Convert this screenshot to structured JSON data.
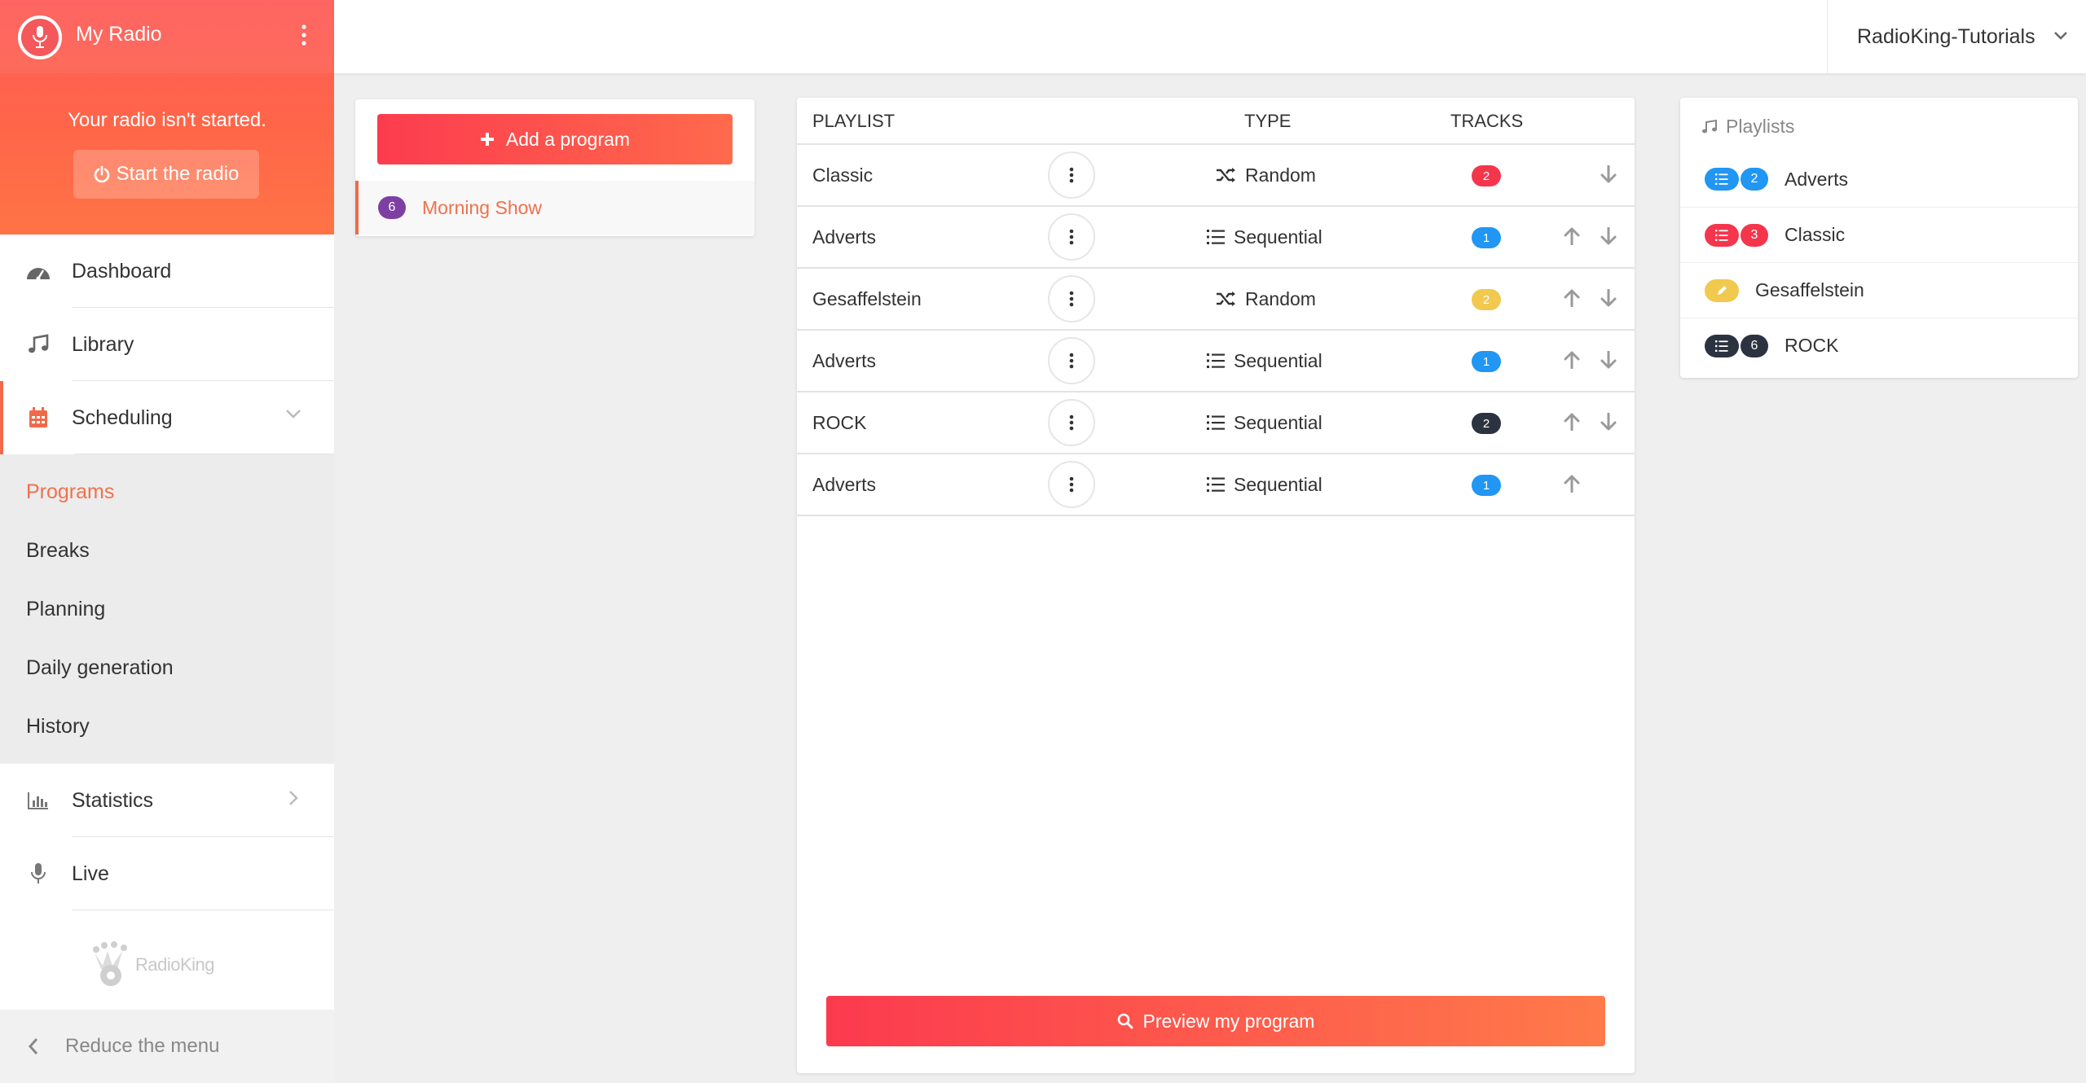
{
  "sidebar": {
    "radio_name": "My Radio",
    "status": "Your radio isn't started.",
    "start_label": "Start the radio",
    "nav": [
      {
        "label": "Dashboard",
        "icon": "dashboard-icon"
      },
      {
        "label": "Library",
        "icon": "music-note-icon"
      },
      {
        "label": "Scheduling",
        "icon": "calendar-icon"
      },
      {
        "label": "Statistics",
        "icon": "bar-chart-icon"
      },
      {
        "label": "Live",
        "icon": "microphone-icon"
      }
    ],
    "submenu": [
      "Programs",
      "Breaks",
      "Planning",
      "Daily generation",
      "History"
    ],
    "brand": "RadioKing",
    "reduce_label": "Reduce the menu"
  },
  "topbar": {
    "account": "RadioKing-Tutorials"
  },
  "programs": {
    "add_label": "Add a program",
    "items": [
      {
        "count": "6",
        "name": "Morning Show"
      }
    ]
  },
  "table": {
    "headers": {
      "playlist": "PLAYLIST",
      "type": "TYPE",
      "tracks": "TRACKS"
    },
    "rows": [
      {
        "playlist": "Classic",
        "type": "Random",
        "tracks": "2",
        "color": "#f4364c",
        "up": false,
        "down": true
      },
      {
        "playlist": "Adverts",
        "type": "Sequential",
        "tracks": "1",
        "color": "#2196f3",
        "up": true,
        "down": true
      },
      {
        "playlist": "Gesaffelstein",
        "type": "Random",
        "tracks": "2",
        "color": "#f0c94e",
        "up": true,
        "down": true
      },
      {
        "playlist": "Adverts",
        "type": "Sequential",
        "tracks": "1",
        "color": "#2196f3",
        "up": true,
        "down": true
      },
      {
        "playlist": "ROCK",
        "type": "Sequential",
        "tracks": "2",
        "color": "#2b3340",
        "up": true,
        "down": true
      },
      {
        "playlist": "Adverts",
        "type": "Sequential",
        "tracks": "1",
        "color": "#2196f3",
        "up": true,
        "down": false
      }
    ],
    "preview_label": "Preview my program"
  },
  "playlists_panel": {
    "title": "Playlists",
    "items": [
      {
        "name": "Adverts",
        "count": "2",
        "color": "#2196f3",
        "icon": "list-icon"
      },
      {
        "name": "Classic",
        "count": "3",
        "color": "#f4364c",
        "icon": "list-icon"
      },
      {
        "name": "Gesaffelstein",
        "count": "",
        "color": "#f0c94e",
        "icon": "pencil-icon"
      },
      {
        "name": "ROCK",
        "count": "6",
        "color": "#2b3340",
        "icon": "list-icon"
      }
    ]
  },
  "colors": {
    "accent": "#f0714c",
    "gradient_start": "#fc3c4e",
    "gradient_end": "#ff7a4a"
  }
}
